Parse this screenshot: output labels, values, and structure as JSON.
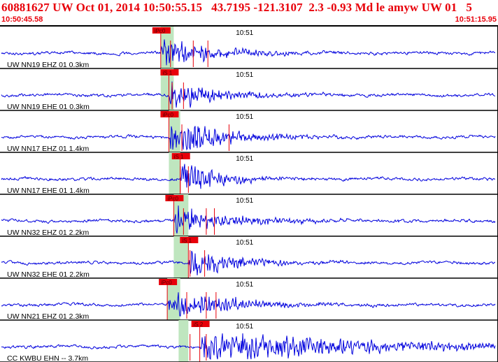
{
  "header": {
    "title": "60881627 UW Oct 01, 2014 10:50:55.15   43.7195 -121.3107  2.3 -0.93 Md le amyw UW 01   5",
    "start_time": "10:50:45.58",
    "end_time": "10:51:15.95"
  },
  "colors": {
    "header_text": "#e8000a",
    "trace": "#0000dd",
    "pick": "#e8000a",
    "window": "#bfe6bf",
    "separator": "#000000"
  },
  "time_axis": {
    "start_s": 0.0,
    "end_s": 30.37,
    "tick_label": "10:51",
    "tick_s": 14.42
  },
  "traces": [
    {
      "label": "UW NN19 EHZ 01 0.3km",
      "pick": "iPc0",
      "pick_s": 9.8,
      "window": [
        9.8,
        10.6
      ],
      "amp": 0.55,
      "decay": 3.5,
      "extra_marks": [
        10.4,
        11.8,
        12.7
      ]
    },
    {
      "label": "UW NN19 EHE 01 0.3km",
      "pick": "iS 1",
      "pick_s": 10.3,
      "window": [
        9.8,
        10.6
      ],
      "amp": 0.62,
      "decay": 3.0,
      "extra_marks": [
        10.5,
        11.2
      ]
    },
    {
      "label": "UW NN17 EHZ 01 1.4km",
      "pick": "iPc0",
      "pick_s": 10.3,
      "window": [
        10.3,
        11.0
      ],
      "amp": 0.85,
      "decay": 3.2,
      "extra_marks": [
        11.1,
        14.0
      ]
    },
    {
      "label": "UW NN17 EHE 01 1.4km",
      "pick": "iS 1",
      "pick_s": 11.0,
      "window": [
        10.3,
        11.0
      ],
      "amp": 0.72,
      "decay": 2.5,
      "extra_marks": [
        11.0,
        11.5
      ]
    },
    {
      "label": "UW NN32 EHZ 01 2.2km",
      "pick": "iPc0",
      "pick_s": 10.6,
      "window": [
        10.6,
        11.5
      ],
      "amp": 0.55,
      "decay": 3.8,
      "extra_marks": [
        11.2,
        12.6,
        13.1
      ]
    },
    {
      "label": "UW NN32 EHE 01 2.2km",
      "pick": "iS 1",
      "pick_s": 11.5,
      "window": [
        10.6,
        11.5
      ],
      "amp": 0.58,
      "decay": 3.0,
      "extra_marks": [
        11.6,
        12.5
      ]
    },
    {
      "label": "UW NN21 EHZ 01 2.3km",
      "pick": "iPc0",
      "pick_s": 10.2,
      "window": [
        10.2,
        11.0
      ],
      "amp": 0.55,
      "decay": 4.0,
      "extra_marks": [
        11.4,
        12.6,
        13.2
      ]
    },
    {
      "label": "CC KWBU EHN -- 3.7km",
      "pick": "iS 2",
      "pick_s": 12.2,
      "window": [
        10.9,
        11.5
      ],
      "amp": 0.68,
      "decay": 10.0,
      "extra_marks": [
        11.6,
        12.6
      ]
    }
  ]
}
